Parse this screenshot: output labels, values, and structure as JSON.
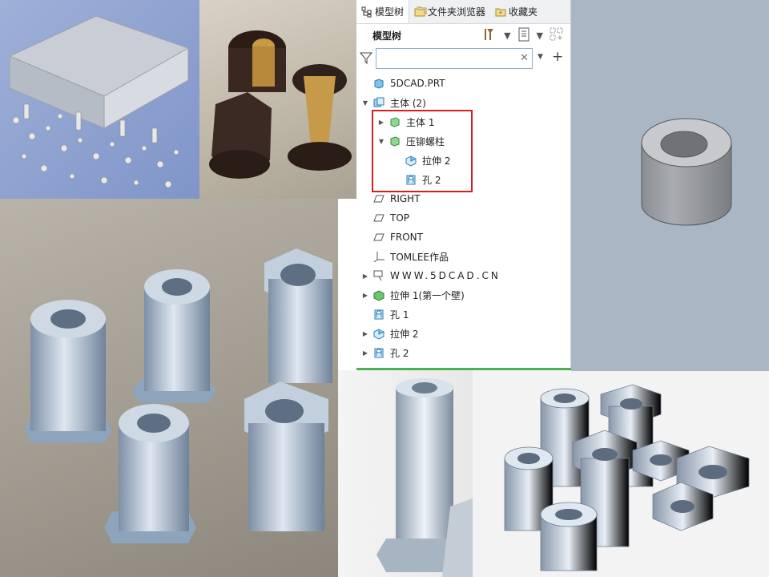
{
  "photos": {
    "chassis": "sheet-metal-chassis-with-fasteners-photo",
    "brass": "brass-threaded-inserts-photo",
    "standoffs": "zinc-plated-standoffs-photo",
    "single": "single-standoff-photo",
    "group": "hex-standoff-group-photo"
  },
  "panel": {
    "tabs": [
      {
        "label": "模型树",
        "icon": "model-tree-icon"
      },
      {
        "label": "文件夹浏览器",
        "icon": "folder-icon"
      },
      {
        "label": "收藏夹",
        "icon": "favorites-icon"
      }
    ],
    "title": "模型树",
    "filter_placeholder": "",
    "tree": [
      {
        "label": "5DCAD.PRT",
        "arrow": "",
        "icon": "part-icon",
        "indent": 0
      },
      {
        "label": "主体 (2)",
        "arrow": "▼",
        "icon": "bodies-icon",
        "indent": 0
      },
      {
        "label": "主体 1",
        "arrow": "▶",
        "icon": "body-icon",
        "indent": 1
      },
      {
        "label": "压铆螺柱",
        "arrow": "▼",
        "icon": "body-icon",
        "indent": 1
      },
      {
        "label": "拉伸 2",
        "arrow": "",
        "icon": "extrude-icon",
        "indent": 2
      },
      {
        "label": "孔 2",
        "arrow": "",
        "icon": "hole-icon",
        "indent": 2
      },
      {
        "label": "RIGHT",
        "arrow": "",
        "icon": "datum-plane-icon",
        "indent": 0
      },
      {
        "label": "TOP",
        "arrow": "",
        "icon": "datum-plane-icon",
        "indent": 0
      },
      {
        "label": "FRONT",
        "arrow": "",
        "icon": "datum-plane-icon",
        "indent": 0
      },
      {
        "label": "TOMLEE作品",
        "arrow": "",
        "icon": "coordinate-system-icon",
        "indent": 0
      },
      {
        "label": "WWW.5DCAD.CN",
        "arrow": "▶",
        "icon": "annotation-icon",
        "indent": 0
      },
      {
        "label": "拉伸 1(第一个壁)",
        "arrow": "▶",
        "icon": "extrude-green-icon",
        "indent": 0
      },
      {
        "label": "孔 1",
        "arrow": "",
        "icon": "hole-icon",
        "indent": 0
      },
      {
        "label": "拉伸 2",
        "arrow": "▶",
        "icon": "extrude-icon",
        "indent": 0
      },
      {
        "label": "孔 2",
        "arrow": "▶",
        "icon": "hole-icon",
        "indent": 0
      }
    ]
  },
  "viewport": {
    "model": "cylinder-standoff-3d-model"
  },
  "colors": {
    "highlight": "#d81e1e",
    "accent": "#4caf50",
    "viewport_bg": "#a9b7c4"
  }
}
